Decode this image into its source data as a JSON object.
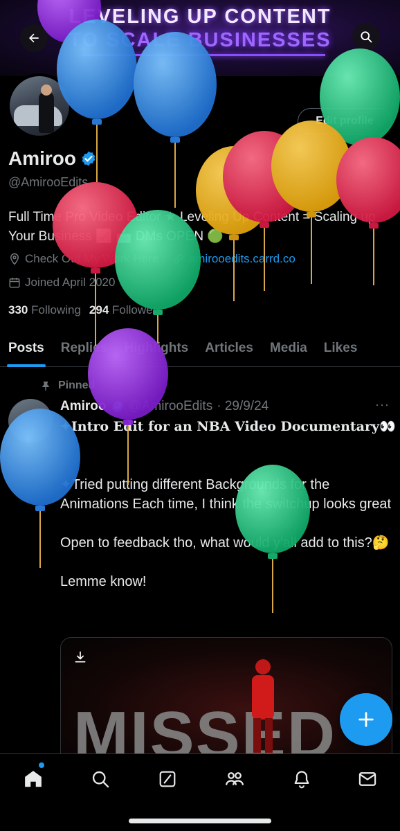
{
  "banner": {
    "line1": "LEVELING UP CONTENT",
    "line2": "TO SCALE BUSINESSES"
  },
  "header": {
    "back_icon": "arrow-left-icon",
    "search_icon": "search-icon"
  },
  "profile": {
    "edit_label": "Edit profile",
    "display_name": "Amiroo",
    "handle": "@AmirooEdits",
    "bio": "Full Time Pro Video Editor ★ Leveling Up Content = Scaling up Your Business 📈 📩 DMs OPEN 🟢",
    "location": "Check Out My Work Here :",
    "website": "amirooedits.carrd.co",
    "joined": "Joined April 2020",
    "following_count": "330",
    "following_label": "Following",
    "followers_count": "294",
    "followers_label": "Followers"
  },
  "tabs": [
    "Posts",
    "Replies",
    "Highlights",
    "Articles",
    "Media",
    "Likes"
  ],
  "post": {
    "pinned_label": "Pinned",
    "name": "Amiroo",
    "handle": "@AmirooEdits",
    "date": "· 29/9/24",
    "more": "···",
    "title": "✦Intro Edit for an NBA Video Documentary👀",
    "body": "✦Tried putting different Backgrounds for the Animations Each time, I think the switchup looks great\n\nOpen to feedback tho, what would y'all add to this?🤔\n\nLemme know!",
    "media_text": "MISSED"
  },
  "colors": {
    "accent": "#1d9bf0",
    "background": "#000000",
    "text_primary": "#e7e9ea",
    "text_secondary": "#71767b"
  },
  "nav": [
    "home-icon",
    "search-icon",
    "grok-icon",
    "communities-icon",
    "notifications-icon",
    "messages-icon"
  ]
}
